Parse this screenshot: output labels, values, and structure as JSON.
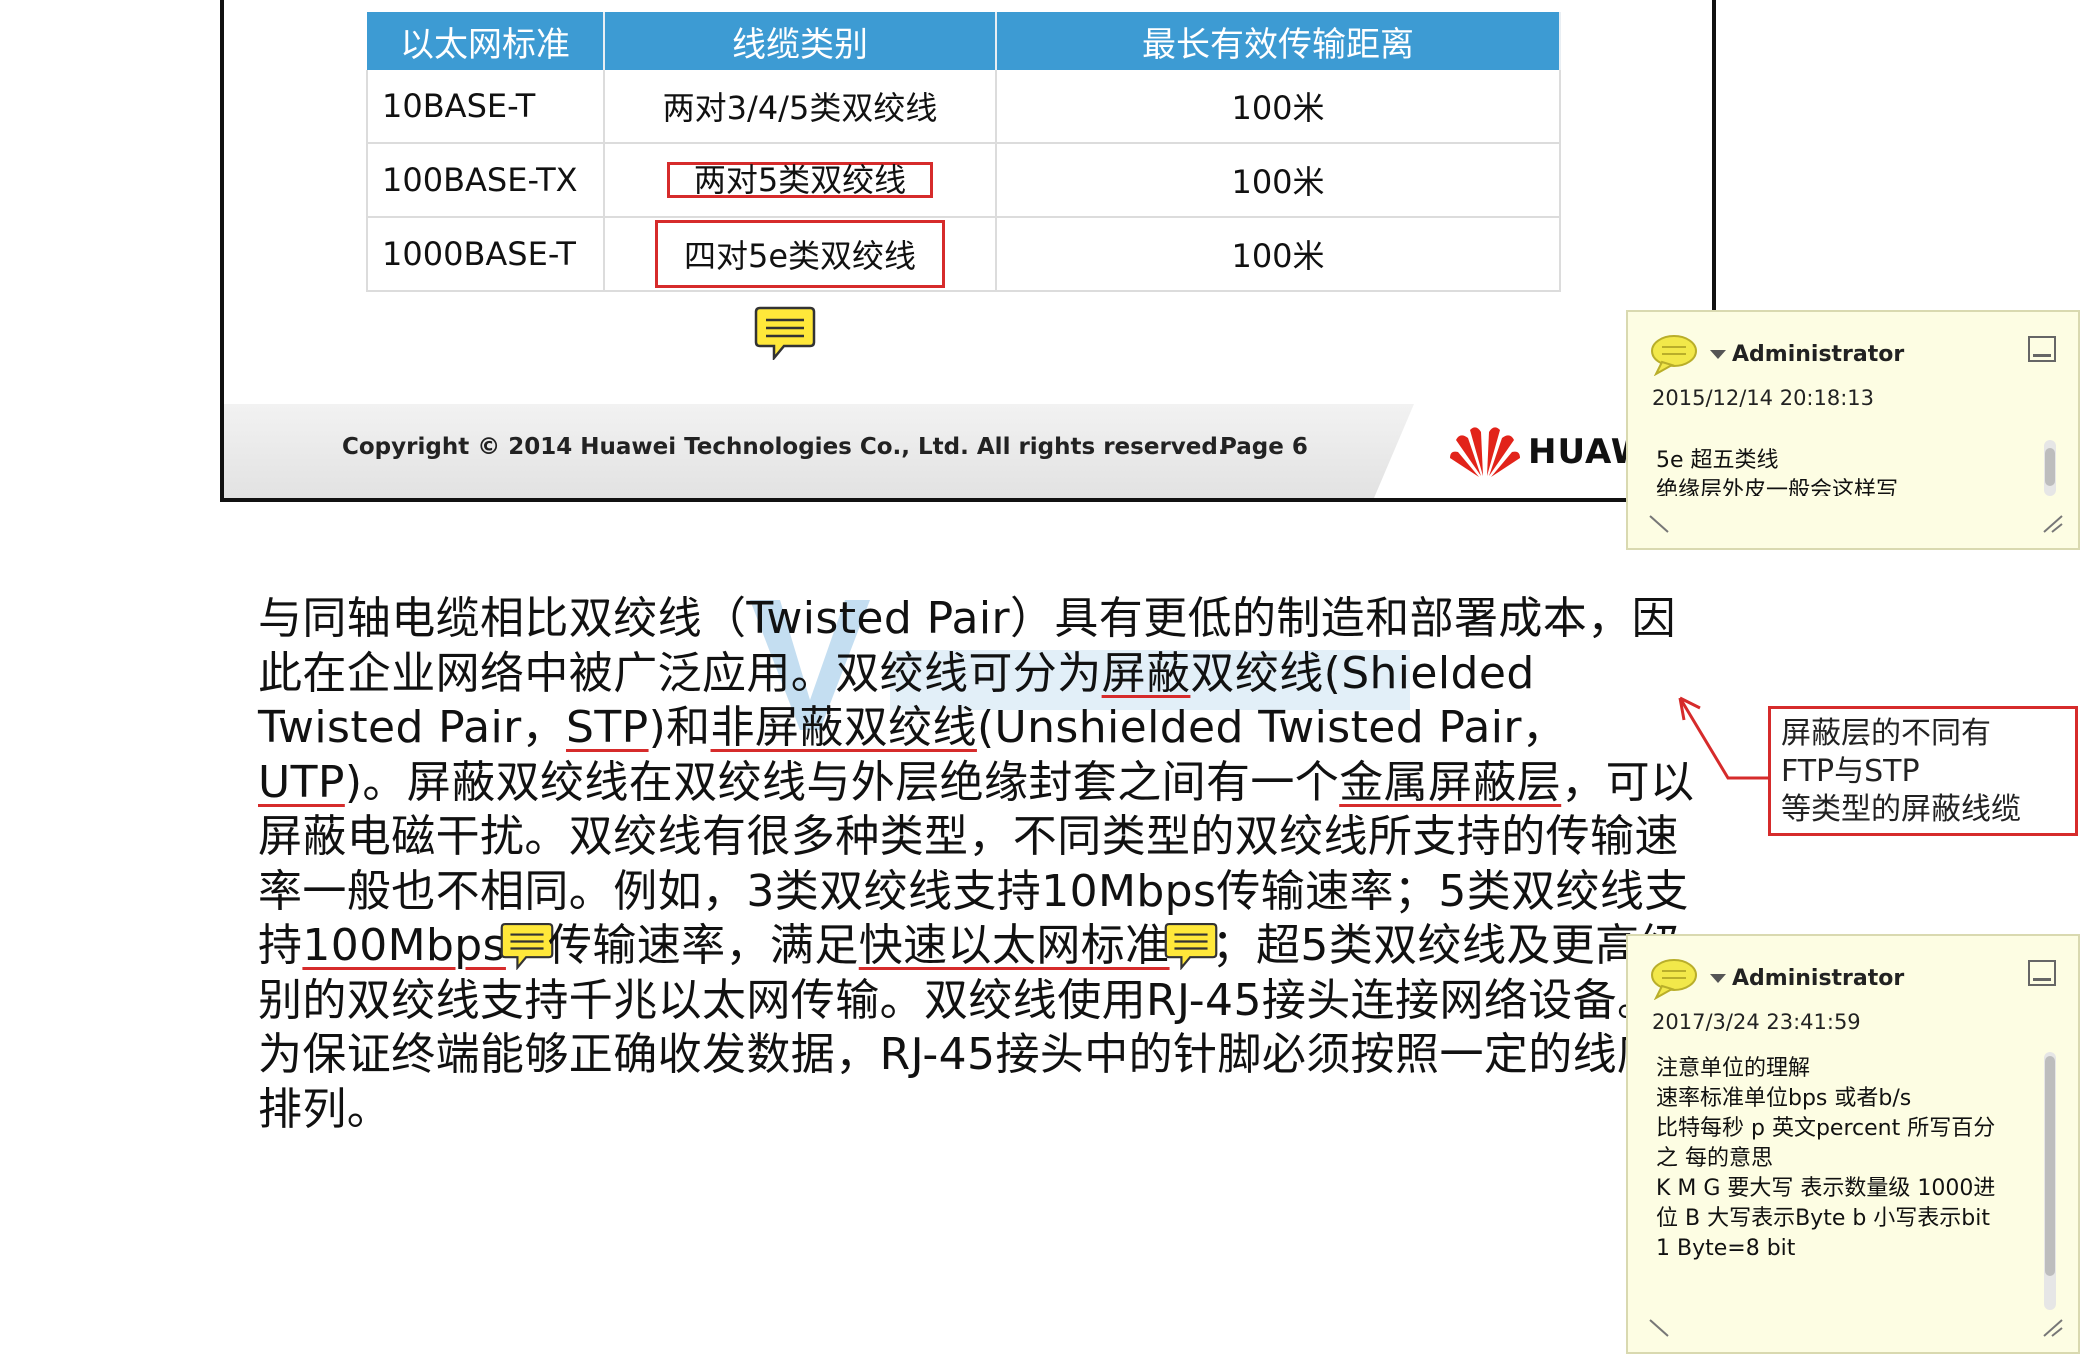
{
  "slide": {
    "table": {
      "headers": [
        "以太网标准",
        "线缆类别",
        "最长有效传输距离"
      ],
      "rows": [
        [
          "10BASE-T",
          "两对3/4/5类双绞线",
          "100米"
        ],
        [
          "100BASE-TX",
          "两对5类双绞线",
          "100米"
        ],
        [
          "1000BASE-T",
          "四对5e类双绞线",
          "100米"
        ]
      ]
    },
    "footer": {
      "copyright": "Copyright © 2014 Huawei Technologies Co., Ltd. All rights reserved.",
      "page": "Page 6",
      "brand": "HUAWE"
    }
  },
  "body_text": {
    "p1": "与同轴电缆相比双绞线（Twisted Pair）具有更低的制造和部署成本，因此在企业网络中被广泛应用。双绞线可分为",
    "u1": "屏蔽",
    "p2": "双绞线(Shielded Twisted Pair，",
    "u2": "STP",
    "p3": ")和",
    "u3": "非屏蔽双绞线",
    "p4": "(Unshielded Twisted Pair，",
    "u4": "UTP",
    "p5": ")。屏蔽双绞线在双绞线与外层绝缘封套之间有一个",
    "u5": "金属屏蔽层",
    "p6": "，可以屏蔽电磁干扰。双绞线有很多种类型，不同类型的双绞线所支持的传输速率一般也不相同。例如，3类双绞线支持10Mbps传输速率；5类双绞线支持",
    "u6": "100Mbps",
    "p7": "传输速率，满足",
    "u7": "快速以太网标准",
    "p8": "；超5类双绞线及更高级别的双绞线支持千兆以太网传输。双绞线使用RJ-45接头连接网络设备。为保证终端能够正确收发数据，RJ-45接头中的针脚必须按照一定的线序排列。"
  },
  "annotation": {
    "lines": [
      "屏蔽层的不同有",
      "FTP与STP",
      "等类型的屏蔽线缆"
    ],
    "color": "#d62b2b"
  },
  "notes": [
    {
      "author": "Administrator",
      "date": "2015/12/14 20:18:13",
      "lines": [
        "5e 超五类线",
        "绝缘层外皮一般会这样写"
      ]
    },
    {
      "author": "Administrator",
      "date": "2017/3/24 23:41:59",
      "lines": [
        "注意单位的理解",
        "速率标准单位bps 或者b/s",
        "比特每秒 p 英文percent 所写百分",
        "之 每的意思",
        "K M G 要大写 表示数量级 1000进",
        "位 B 大写表示Byte b 小写表示bit",
        "1 Byte=8 bit"
      ]
    }
  ],
  "icons": {
    "comment": "speech-bubble-icon",
    "note": "speech-bubble-icon",
    "minimize": "minimize-icon",
    "resize": "resize-grip-icon"
  },
  "colors": {
    "table_header": "#3d9bd3",
    "note_bg": "#fdfde3",
    "comment_yellow": "#ffe83a"
  }
}
